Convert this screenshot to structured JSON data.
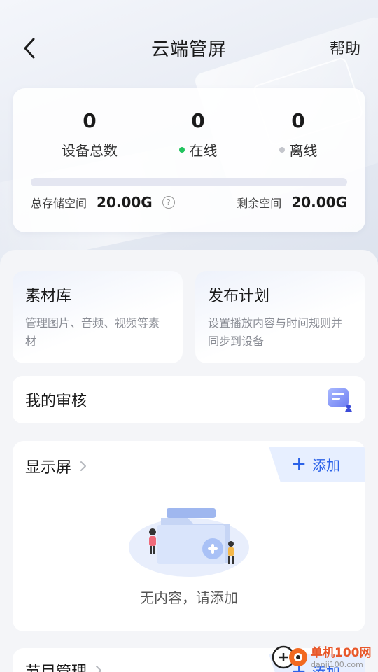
{
  "header": {
    "title": "云端管屏",
    "help_label": "帮助"
  },
  "stats": {
    "total": {
      "value": "0",
      "label": "设备总数"
    },
    "online": {
      "value": "0",
      "label": "在线",
      "dot_color": "#22c35e"
    },
    "offline": {
      "value": "0",
      "label": "离线",
      "dot_color": "#c4c6cc"
    },
    "storage": {
      "total_label": "总存储空间",
      "total_value": "20.00G",
      "remaining_label": "剩余空间",
      "remaining_value": "20.00G",
      "used_fraction": 0
    }
  },
  "features": {
    "library": {
      "title": "素材库",
      "desc": "管理图片、音频、视频等素材"
    },
    "publish": {
      "title": "发布计划",
      "desc": "设置播放内容与时间规则并同步到设备"
    }
  },
  "review": {
    "title": "我的审核"
  },
  "display": {
    "title": "显示屏",
    "add_label": "添加",
    "empty_text": "无内容，请添加"
  },
  "program": {
    "title": "节目管理",
    "add_label": "添加"
  },
  "watermark": {
    "name": "单机100网",
    "url": "danji100.com"
  },
  "colors": {
    "accent": "#2b62e8",
    "online": "#22c35e",
    "offline": "#c4c6cc"
  }
}
